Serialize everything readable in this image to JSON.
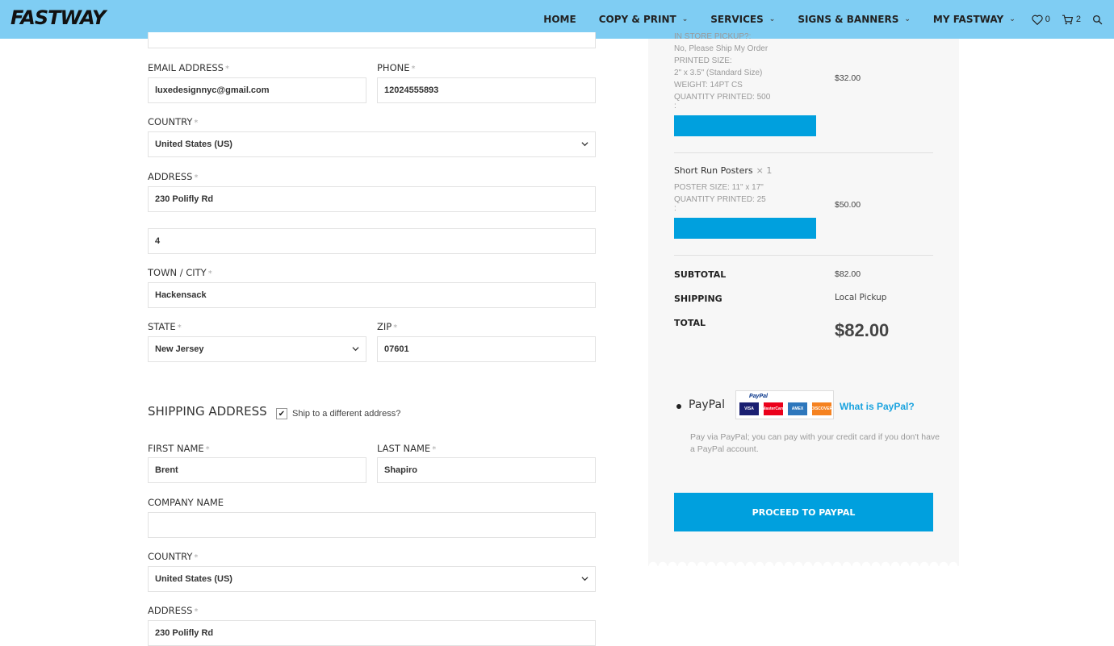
{
  "header": {
    "logo": "FASTWAY",
    "nav": [
      "HOME",
      "COPY & PRINT",
      "SERVICES",
      "SIGNS & BANNERS",
      "MY FASTWAY"
    ],
    "wishlist_count": "0",
    "cart_count": "2"
  },
  "billing": {
    "email_label": "EMAIL ADDRESS",
    "email_value": "luxedesignnyc@gmail.com",
    "phone_label": "PHONE",
    "phone_value": "12024555893",
    "country_label": "COUNTRY",
    "country_value": "United States (US)",
    "address_label": "ADDRESS",
    "address_value": "230 Polifly Rd",
    "address2_value": "4",
    "city_label": "TOWN / CITY",
    "city_value": "Hackensack",
    "state_label": "STATE",
    "state_value": "New Jersey",
    "zip_label": "ZIP",
    "zip_value": "07601",
    "required_mark": "*"
  },
  "shipping": {
    "title": "SHIPPING ADDRESS",
    "ship_different_label": "Ship to a different address?",
    "check_mark": "✔",
    "first_name_label": "FIRST NAME",
    "first_name_value": "Brent",
    "last_name_label": "LAST NAME",
    "last_name_value": "Shapiro",
    "company_label": "COMPANY NAME",
    "company_value": "",
    "country_label": "COUNTRY",
    "country_value": "United States (US)",
    "address_label": "ADDRESS",
    "address_value": "230 Polifly Rd"
  },
  "order": {
    "item1": {
      "meta": [
        "IN STORE PICKUP?:",
        "No, Please Ship My Order",
        "PRINTED SIZE:",
        "2\" x 3.5\" (Standard Size)",
        "WEIGHT: 14PT CS",
        "QUANTITY PRINTED: 500",
        ":"
      ],
      "price": "$32.00"
    },
    "item2": {
      "name": "Short Run Posters",
      "qty": "× 1",
      "meta": [
        "POSTER SIZE: 11\" x 17\"",
        "QUANTITY PRINTED: 25",
        ":"
      ],
      "price": "$50.00"
    },
    "subtotal_label": "SUBTOTAL",
    "subtotal_value": "$82.00",
    "shipping_label": "SHIPPING",
    "shipping_value": "Local Pickup",
    "total_label": "TOTAL",
    "total_value": "$82.00"
  },
  "payment": {
    "method": "PayPal",
    "logo_text": "PayPal",
    "cards": [
      "VISA",
      "MasterCard",
      "AMEX",
      "DISCOVER"
    ],
    "what_is": "What is PayPal?",
    "description": "Pay via PayPal; you can pay with your credit card if you don't have a PayPal account.",
    "proceed_label": "PROCEED TO PAYPAL"
  },
  "colors": {
    "header_bg": "#7fcdf3",
    "accent": "#00a0de",
    "link": "#1aa3df"
  }
}
